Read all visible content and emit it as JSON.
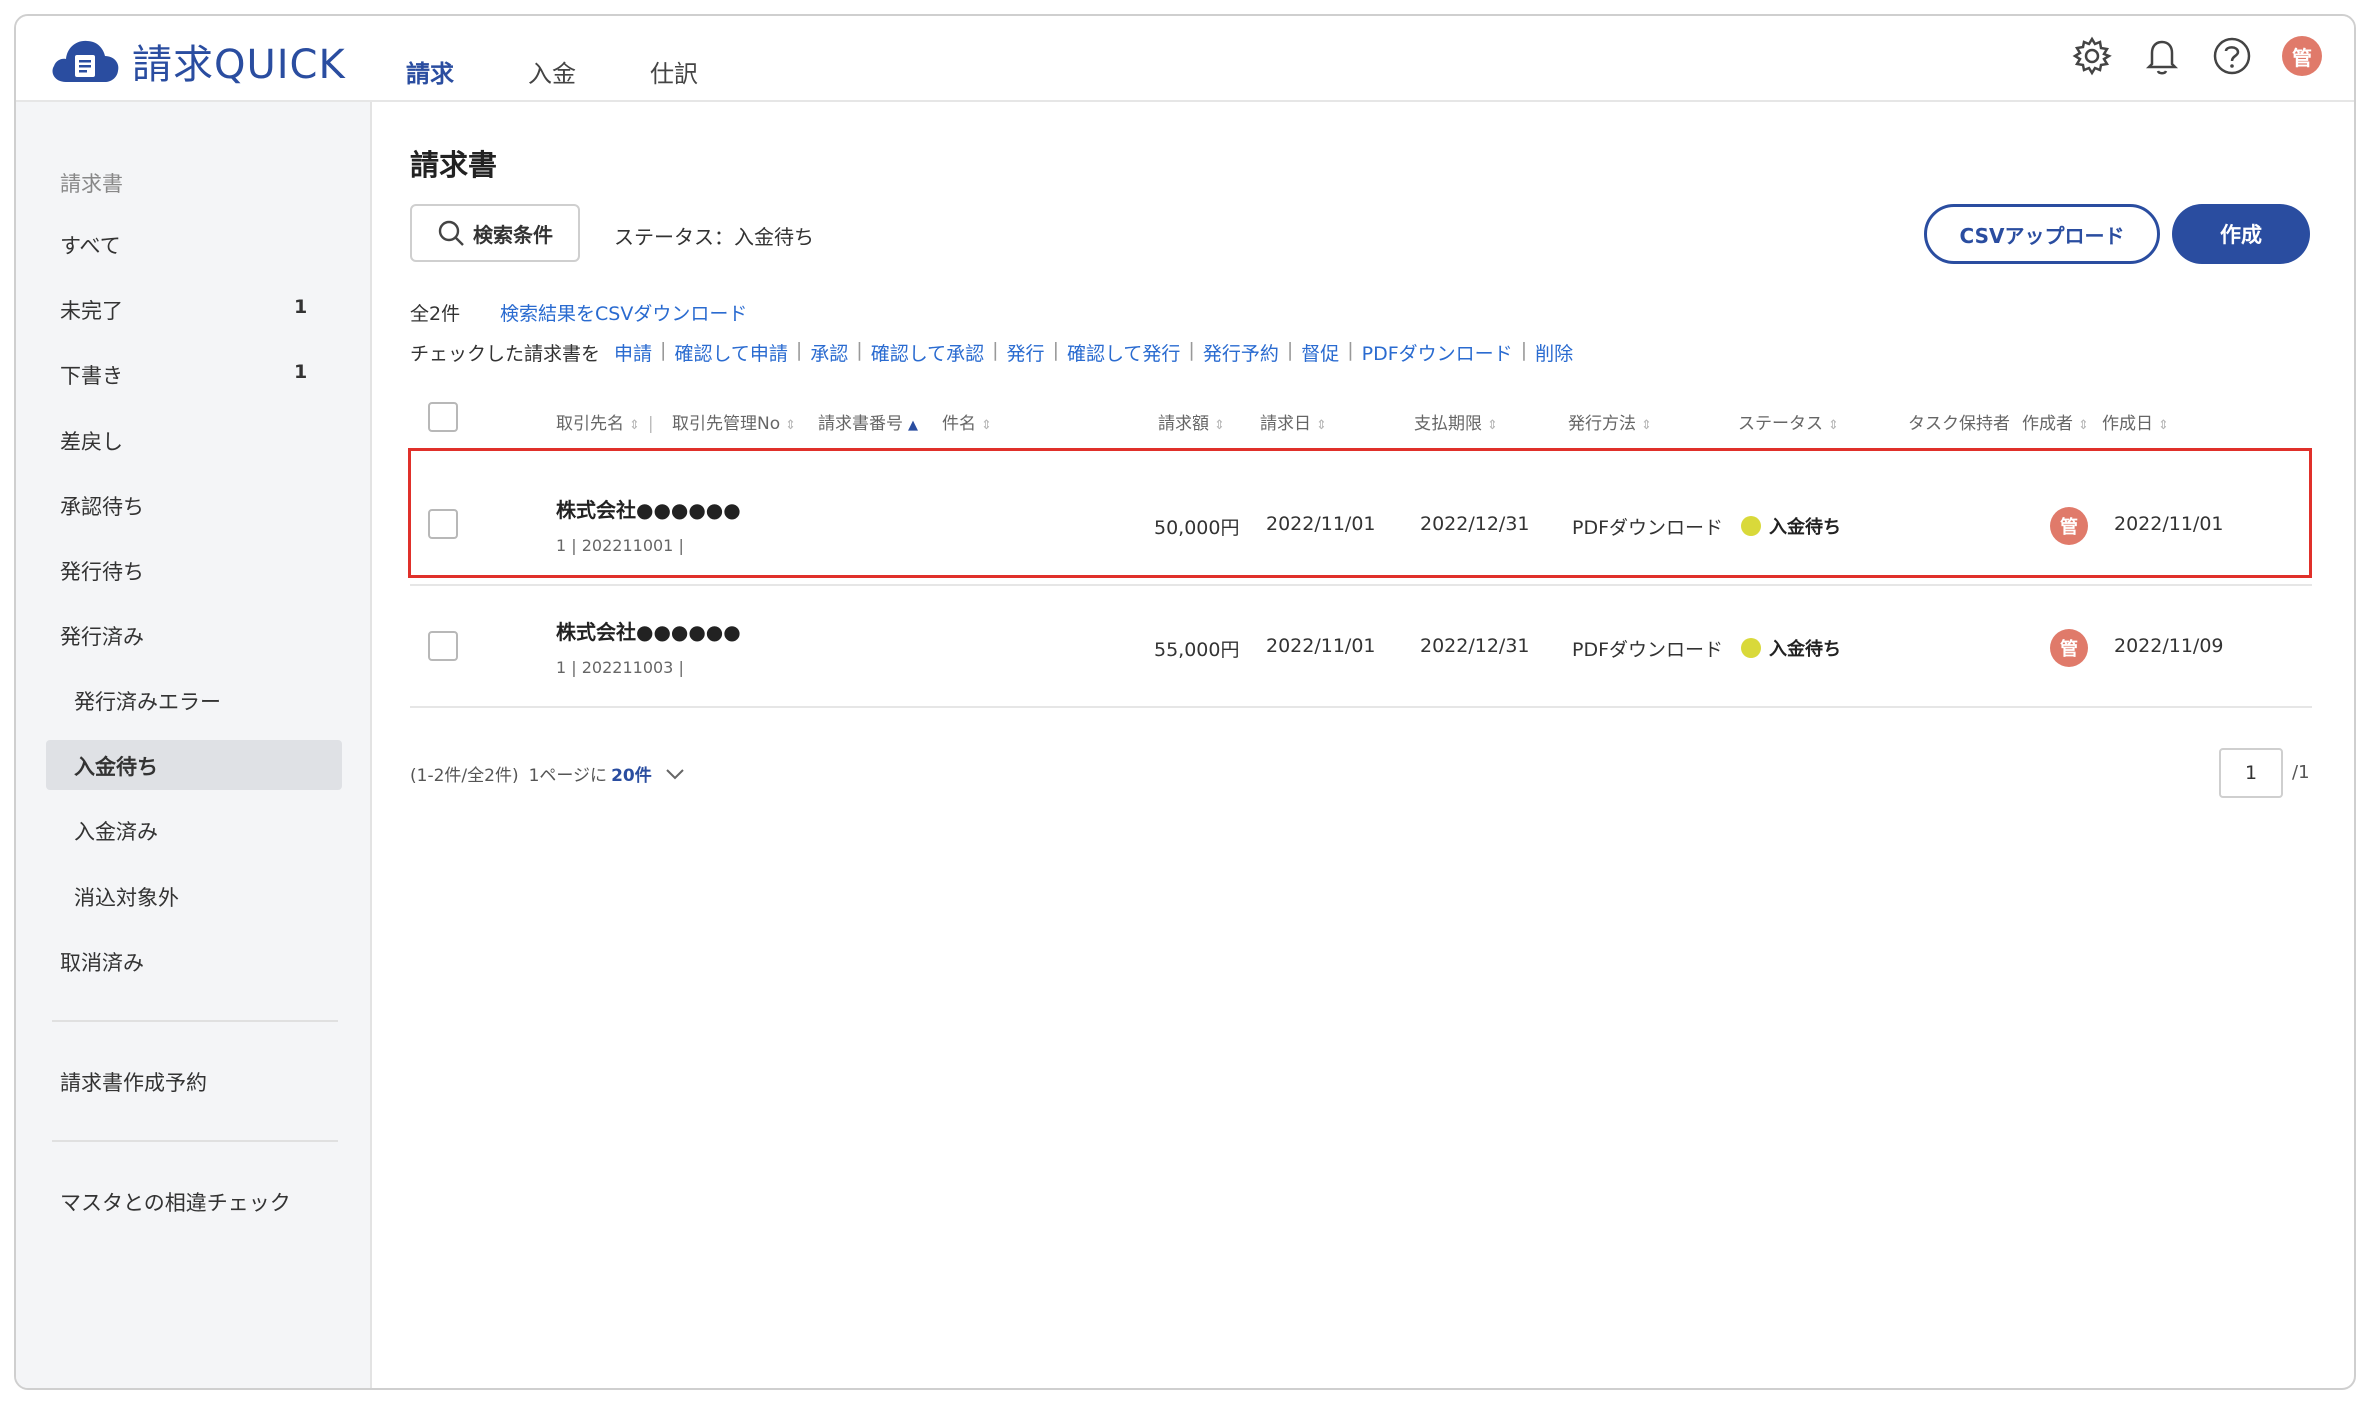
{
  "app": {
    "name": "請求QUICK"
  },
  "nav": {
    "items": [
      "請求",
      "入金",
      "仕訳"
    ],
    "active": "請求"
  },
  "header": {
    "user_initial": "管"
  },
  "sidebar": {
    "section_title": "請求書",
    "all": "すべて",
    "incomplete": {
      "label": "未完了",
      "count": "1"
    },
    "draft": {
      "label": "下書き",
      "count": "1"
    },
    "returned": "差戻し",
    "awaiting_approval": "承認待ち",
    "awaiting_issue": "発行待ち",
    "issued": "発行済み",
    "issued_error": "発行済みエラー",
    "awaiting_payment": "入金待ち",
    "paid": "入金済み",
    "not_reconciled": "消込対象外",
    "cancelled": "取消済み",
    "reservation": "請求書作成予約",
    "master_check": "マスタとの相違チェック"
  },
  "main": {
    "title": "請求書",
    "search_label": "検索条件",
    "status_filter": "ステータス：入金待ち",
    "csv_upload": "CSVアップロード",
    "create": "作成",
    "total": "全2件",
    "csv_download": "検索結果をCSVダウンロード",
    "bulk_lead": "チェックした請求書を",
    "bulk_actions": [
      "申請",
      "確認して申請",
      "承認",
      "確認して承認",
      "発行",
      "確認して発行",
      "発行予約",
      "督促",
      "PDFダウンロード",
      "削除"
    ]
  },
  "table": {
    "headers": {
      "client": "取引先名",
      "client_no": "取引先管理No",
      "invoice_no": "請求書番号",
      "subject": "件名",
      "amount": "請求額",
      "invoice_date": "請求日",
      "due_date": "支払期限",
      "method": "発行方法",
      "status": "ステータス",
      "task_holder": "タスク保持者",
      "creator": "作成者",
      "created": "作成日"
    },
    "rows": [
      {
        "client": "株式会社●●●●●●",
        "sub": "1 | 202211001 |",
        "amount": "50,000円",
        "invoice_date": "2022/11/01",
        "due_date": "2022/12/31",
        "method": "PDFダウンロード",
        "status": "入金待ち",
        "creator": "管",
        "created": "2022/11/01"
      },
      {
        "client": "株式会社●●●●●●",
        "sub": "1 | 202211003 |",
        "amount": "55,000円",
        "invoice_date": "2022/11/01",
        "due_date": "2022/12/31",
        "method": "PDFダウンロード",
        "status": "入金待ち",
        "creator": "管",
        "created": "2022/11/09"
      }
    ]
  },
  "pagination": {
    "range": "(1-2件/全2件)",
    "per_page_label": "1ページに",
    "per_page": "20件",
    "current": "1",
    "total": "/1"
  },
  "colors": {
    "brand": "#2a4da0",
    "link": "#2a6bd0",
    "highlight": "#e0302a",
    "status_dot": "#d9d93a",
    "avatar": "#e07a6a"
  },
  "icons": [
    "cloud-logo-icon",
    "gear-icon",
    "bell-icon",
    "help-icon",
    "search-icon",
    "chevron-down-icon",
    "sort-icon"
  ]
}
